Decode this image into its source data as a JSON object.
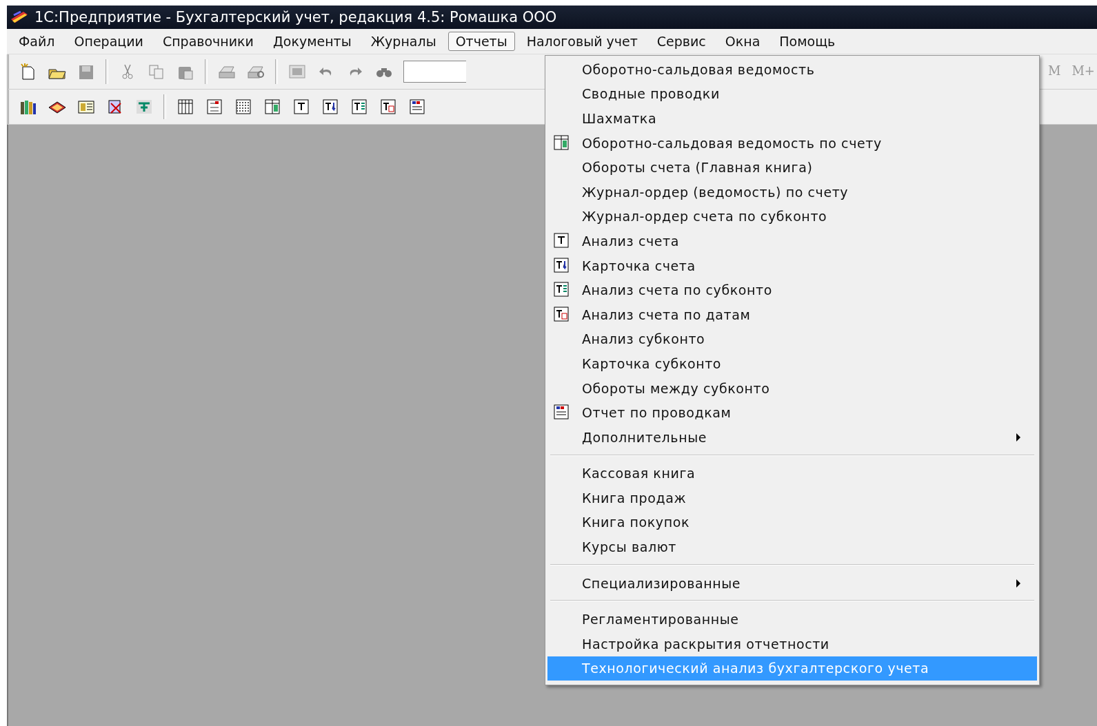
{
  "window": {
    "title": "1С:Предприятие - Бухгалтерский учет, редакция 4.5: Ромашка ООО"
  },
  "menu_bar": [
    {
      "label": "Файл",
      "selected": false
    },
    {
      "label": "Операции",
      "selected": false
    },
    {
      "label": "Справочники",
      "selected": false
    },
    {
      "label": "Документы",
      "selected": false
    },
    {
      "label": "Журналы",
      "selected": false
    },
    {
      "label": "Отчеты",
      "selected": true
    },
    {
      "label": "Налоговый учет",
      "selected": false
    },
    {
      "label": "Сервис",
      "selected": false
    },
    {
      "label": "Окна",
      "selected": false
    },
    {
      "label": "Помощь",
      "selected": false
    }
  ],
  "toolbar_right": [
    "М",
    "М+"
  ],
  "reports_menu": {
    "items": [
      {
        "kind": "item",
        "label": "Оборотно-сальдовая ведомость",
        "has_icon": false,
        "selected": false
      },
      {
        "kind": "item",
        "label": "Сводные проводки",
        "has_icon": false,
        "selected": false
      },
      {
        "kind": "item",
        "label": "Шахматка",
        "has_icon": false,
        "selected": false
      },
      {
        "kind": "item",
        "label": "Оборотно-сальдовая ведомость по счету",
        "has_icon": true,
        "selected": false
      },
      {
        "kind": "item",
        "label": "Обороты счета (Главная книга)",
        "has_icon": false,
        "selected": false
      },
      {
        "kind": "item",
        "label": "Журнал-ордер (ведомость) по счету",
        "has_icon": false,
        "selected": false
      },
      {
        "kind": "item",
        "label": "Журнал-ордер счета по субконто",
        "has_icon": false,
        "selected": false
      },
      {
        "kind": "item",
        "label": "Анализ счета",
        "has_icon": true,
        "selected": false
      },
      {
        "kind": "item",
        "label": "Карточка счета",
        "has_icon": true,
        "selected": false
      },
      {
        "kind": "item",
        "label": "Анализ счета по субконто",
        "has_icon": true,
        "selected": false
      },
      {
        "kind": "item",
        "label": "Анализ счета по датам",
        "has_icon": true,
        "selected": false
      },
      {
        "kind": "item",
        "label": "Анализ субконто",
        "has_icon": false,
        "selected": false
      },
      {
        "kind": "item",
        "label": "Карточка субконто",
        "has_icon": false,
        "selected": false
      },
      {
        "kind": "item",
        "label": "Обороты между субконто",
        "has_icon": false,
        "selected": false
      },
      {
        "kind": "item",
        "label": "Отчет по проводкам",
        "has_icon": true,
        "selected": false
      },
      {
        "kind": "submenu",
        "label": "Дополнительные",
        "has_icon": false,
        "selected": false
      },
      {
        "kind": "separator"
      },
      {
        "kind": "item",
        "label": "Кассовая книга",
        "has_icon": false,
        "selected": false
      },
      {
        "kind": "item",
        "label": "Книга продаж",
        "has_icon": false,
        "selected": false
      },
      {
        "kind": "item",
        "label": "Книга покупок",
        "has_icon": false,
        "selected": false
      },
      {
        "kind": "item",
        "label": "Курсы валют",
        "has_icon": false,
        "selected": false
      },
      {
        "kind": "separator"
      },
      {
        "kind": "submenu",
        "label": "Специализированные",
        "has_icon": false,
        "selected": false
      },
      {
        "kind": "separator"
      },
      {
        "kind": "item",
        "label": "Регламентированные",
        "has_icon": false,
        "selected": false
      },
      {
        "kind": "item",
        "label": "Настройка раскрытия отчетности",
        "has_icon": false,
        "selected": false
      },
      {
        "kind": "item",
        "label": "Технологический анализ бухгалтерского учета",
        "has_icon": false,
        "selected": true
      }
    ]
  }
}
